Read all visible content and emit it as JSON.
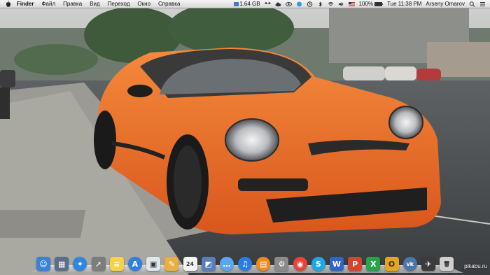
{
  "menubar": {
    "app_name": "Finder",
    "menus": [
      "Файл",
      "Правка",
      "Вид",
      "Переход",
      "Окно",
      "Справка"
    ],
    "status": {
      "memory": "1.64 GB",
      "battery": "100%",
      "datetime": "Tue 11:38 PM",
      "user": "Arseny Omarov"
    }
  },
  "dock": {
    "icons": [
      {
        "name": "finder-icon",
        "color": "#3b82d6",
        "glyph": "☺"
      },
      {
        "name": "dashboard-icon",
        "color": "#5a6f88",
        "glyph": "▦"
      },
      {
        "name": "safari-icon",
        "color": "#2e86de",
        "glyph": "✦"
      },
      {
        "name": "launchpad-icon",
        "color": "#7d7d7d",
        "glyph": "➚"
      },
      {
        "name": "stickies-icon",
        "color": "#f2d34b",
        "glyph": "≡"
      },
      {
        "name": "app-store-icon",
        "color": "#2f7fe0",
        "glyph": "A"
      },
      {
        "name": "preview-icon",
        "color": "#dfe6ee",
        "glyph": "▣"
      },
      {
        "name": "textedit-icon",
        "color": "#e8b043",
        "glyph": "✎"
      },
      {
        "name": "calendar-icon",
        "color": "#f4f4f4",
        "glyph": "24"
      },
      {
        "name": "photo-icon",
        "color": "#5a7fb8",
        "glyph": "◩"
      },
      {
        "name": "messages-icon",
        "color": "#5aa7f0",
        "glyph": "…"
      },
      {
        "name": "itunes-icon",
        "color": "#2a7de1",
        "glyph": "♫"
      },
      {
        "name": "ibooks-icon",
        "color": "#f08a1c",
        "glyph": "▤"
      },
      {
        "name": "system-preferences-icon",
        "color": "#8b8b8b",
        "glyph": "⚙"
      },
      {
        "name": "chrome-icon",
        "color": "#e8443a",
        "glyph": "◉"
      },
      {
        "name": "skype-icon",
        "color": "#1ea7e8",
        "glyph": "S"
      },
      {
        "name": "word-icon",
        "color": "#2f66c4",
        "glyph": "W"
      },
      {
        "name": "powerpoint-icon",
        "color": "#d3452d",
        "glyph": "P"
      },
      {
        "name": "excel-icon",
        "color": "#2aa14b",
        "glyph": "X"
      },
      {
        "name": "outlook-icon",
        "color": "#e7a51f",
        "glyph": "O"
      },
      {
        "name": "vk-icon",
        "color": "#4a76a8",
        "glyph": "vk"
      },
      {
        "name": "counter-strike-icon",
        "color": "#3b3b3b",
        "glyph": "✈"
      },
      {
        "name": "trash-icon",
        "color": "#cfcfcf",
        "glyph": "🗑"
      }
    ]
  },
  "watermark": "pikabu.ru"
}
